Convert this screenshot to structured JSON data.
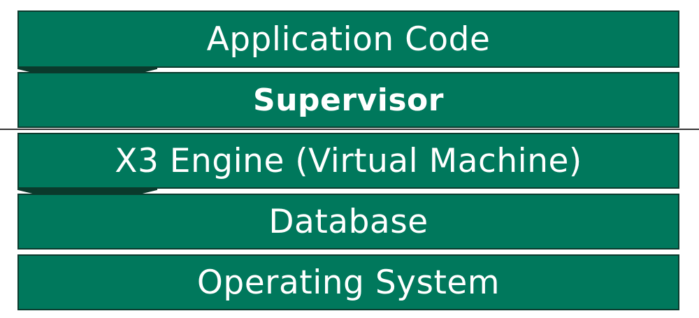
{
  "layers": [
    {
      "label": "Application Code",
      "bold": false
    },
    {
      "label": "Supervisor",
      "bold": true
    },
    {
      "label": "X3 Engine (Virtual Machine)",
      "bold": false
    },
    {
      "label": "Database",
      "bold": false
    },
    {
      "label": "Operating System",
      "bold": false
    }
  ],
  "colors": {
    "layer_fill": "#00785c",
    "layer_border": "#0b3a2d",
    "connector_shadow": "#0a3a2c",
    "text": "#ffffff",
    "divider": "#333333"
  }
}
